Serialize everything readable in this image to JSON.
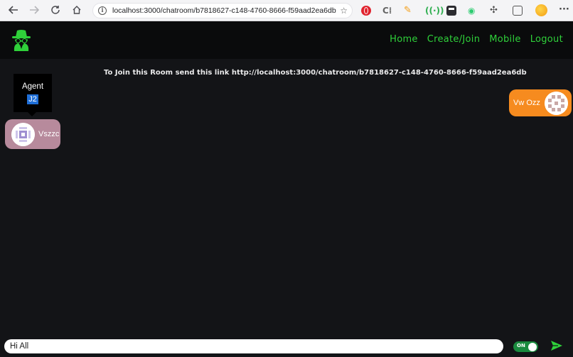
{
  "browser": {
    "url": "localhost:3000/chatroom/b7818627-c148-4760-8666-f59aad2ea6db"
  },
  "navbar": {
    "links": [
      "Home",
      "Create/Join",
      "Mobile",
      "Logout"
    ]
  },
  "chat": {
    "join_message": "To Join this Room send this link http://localhost:3000/chatroom/b7818627-c148-4760-8666-f59aad2ea6db",
    "tooltip": {
      "title": "Agent",
      "id": "J2"
    },
    "self_user": {
      "name": "Vw Ozz",
      "color": "#f68b1f"
    },
    "other_user": {
      "name": "Vszzc",
      "color": "#b78a9c"
    }
  },
  "composer": {
    "input_value": "Hi All",
    "toggle_label": "ON"
  },
  "theme": {
    "accent": "#2fd13a",
    "background": "#131417",
    "navbar": "#0a0b0c"
  }
}
